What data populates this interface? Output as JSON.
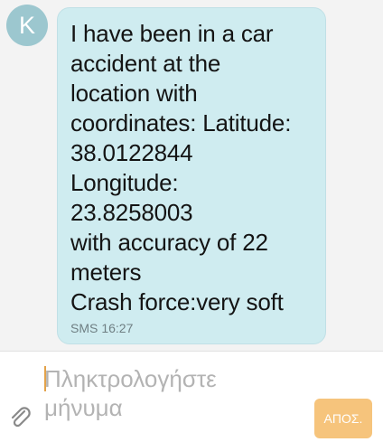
{
  "conversation": {
    "avatar_initial": "K",
    "message": {
      "text": " I have been in a car\naccident at the\nlocation with\ncoordinates: Latitude:\n38.0122844\nLongitude:\n23.8258003\nwith accuracy of 22\nmeters\nCrash force:very soft",
      "type_label": "SMS",
      "time": "16:27"
    }
  },
  "composer": {
    "placeholder": "Πληκτρολογήστε\nμήνυμα",
    "send_label": "ΑΠΟΣ.",
    "attach_icon": "paperclip-icon"
  },
  "colors": {
    "bubble": "#cfecf0",
    "avatar": "#9cc7cf",
    "send_button": "#f6c47c"
  }
}
